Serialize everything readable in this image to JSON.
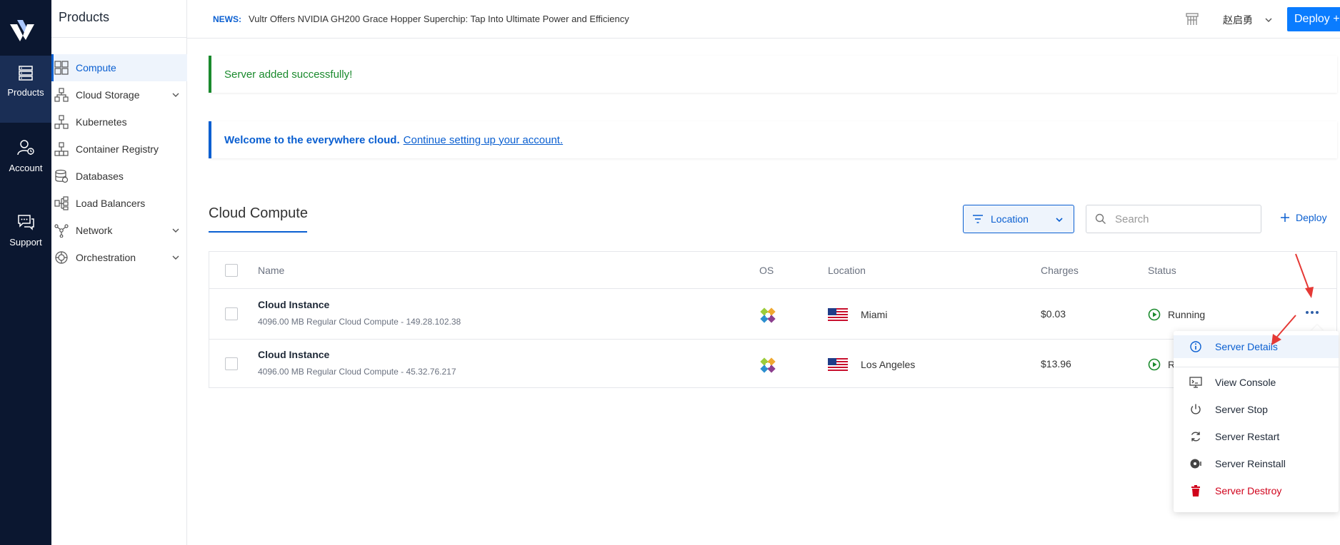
{
  "rail": {
    "items": [
      {
        "label": "Products",
        "icon": "server-stack-icon"
      },
      {
        "label": "Account",
        "icon": "user-icon"
      },
      {
        "label": "Support",
        "icon": "chat-icon"
      }
    ]
  },
  "sidebar": {
    "title": "Products",
    "items": [
      {
        "label": "Compute",
        "icon": "compute-icon"
      },
      {
        "label": "Cloud Storage",
        "icon": "storage-icon"
      },
      {
        "label": "Kubernetes",
        "icon": "kubernetes-icon"
      },
      {
        "label": "Container Registry",
        "icon": "registry-icon"
      },
      {
        "label": "Databases",
        "icon": "database-icon"
      },
      {
        "label": "Load Balancers",
        "icon": "load-balancer-icon"
      },
      {
        "label": "Network",
        "icon": "network-icon"
      },
      {
        "label": "Orchestration",
        "icon": "orchestration-icon"
      }
    ]
  },
  "topbar": {
    "news_tag": "NEWS:",
    "news_text": "Vultr Offers NVIDIA GH200 Grace Hopper Superchip: Tap Into Ultimate Power and Efficiency",
    "user_name": "赵启勇",
    "deploy_label": "Deploy +"
  },
  "alerts": {
    "success": "Server added successfully!",
    "info_bold": "Welcome to the everywhere cloud.",
    "info_link": "Continue setting up your account."
  },
  "section": {
    "title": "Cloud Compute",
    "filter_label": "Location",
    "search_placeholder": "Search",
    "deploy_label": "Deploy"
  },
  "table": {
    "headers": {
      "name": "Name",
      "os": "OS",
      "location": "Location",
      "charges": "Charges",
      "status": "Status"
    },
    "rows": [
      {
        "name": "Cloud Instance",
        "sub": "4096.00 MB Regular Cloud Compute - 149.28.102.38",
        "location": "Miami",
        "charges": "$0.03",
        "status": "Running"
      },
      {
        "name": "Cloud Instance",
        "sub": "4096.00 MB Regular Cloud Compute - 45.32.76.217",
        "location": "Los Angeles",
        "charges": "$13.96",
        "status": "R"
      }
    ]
  },
  "menu": {
    "items": [
      {
        "label": "Server Details",
        "icon": "info-icon"
      },
      {
        "label": "View Console",
        "icon": "console-icon"
      },
      {
        "label": "Server Stop",
        "icon": "power-icon"
      },
      {
        "label": "Server Restart",
        "icon": "restart-icon"
      },
      {
        "label": "Server Reinstall",
        "icon": "reinstall-icon"
      },
      {
        "label": "Server Destroy",
        "icon": "trash-icon"
      }
    ]
  },
  "colors": {
    "rail_bg": "#0b1730",
    "accent": "#0a5fd1",
    "success": "#1a8a2d",
    "danger": "#d0021b",
    "annotation": "#e53935"
  }
}
